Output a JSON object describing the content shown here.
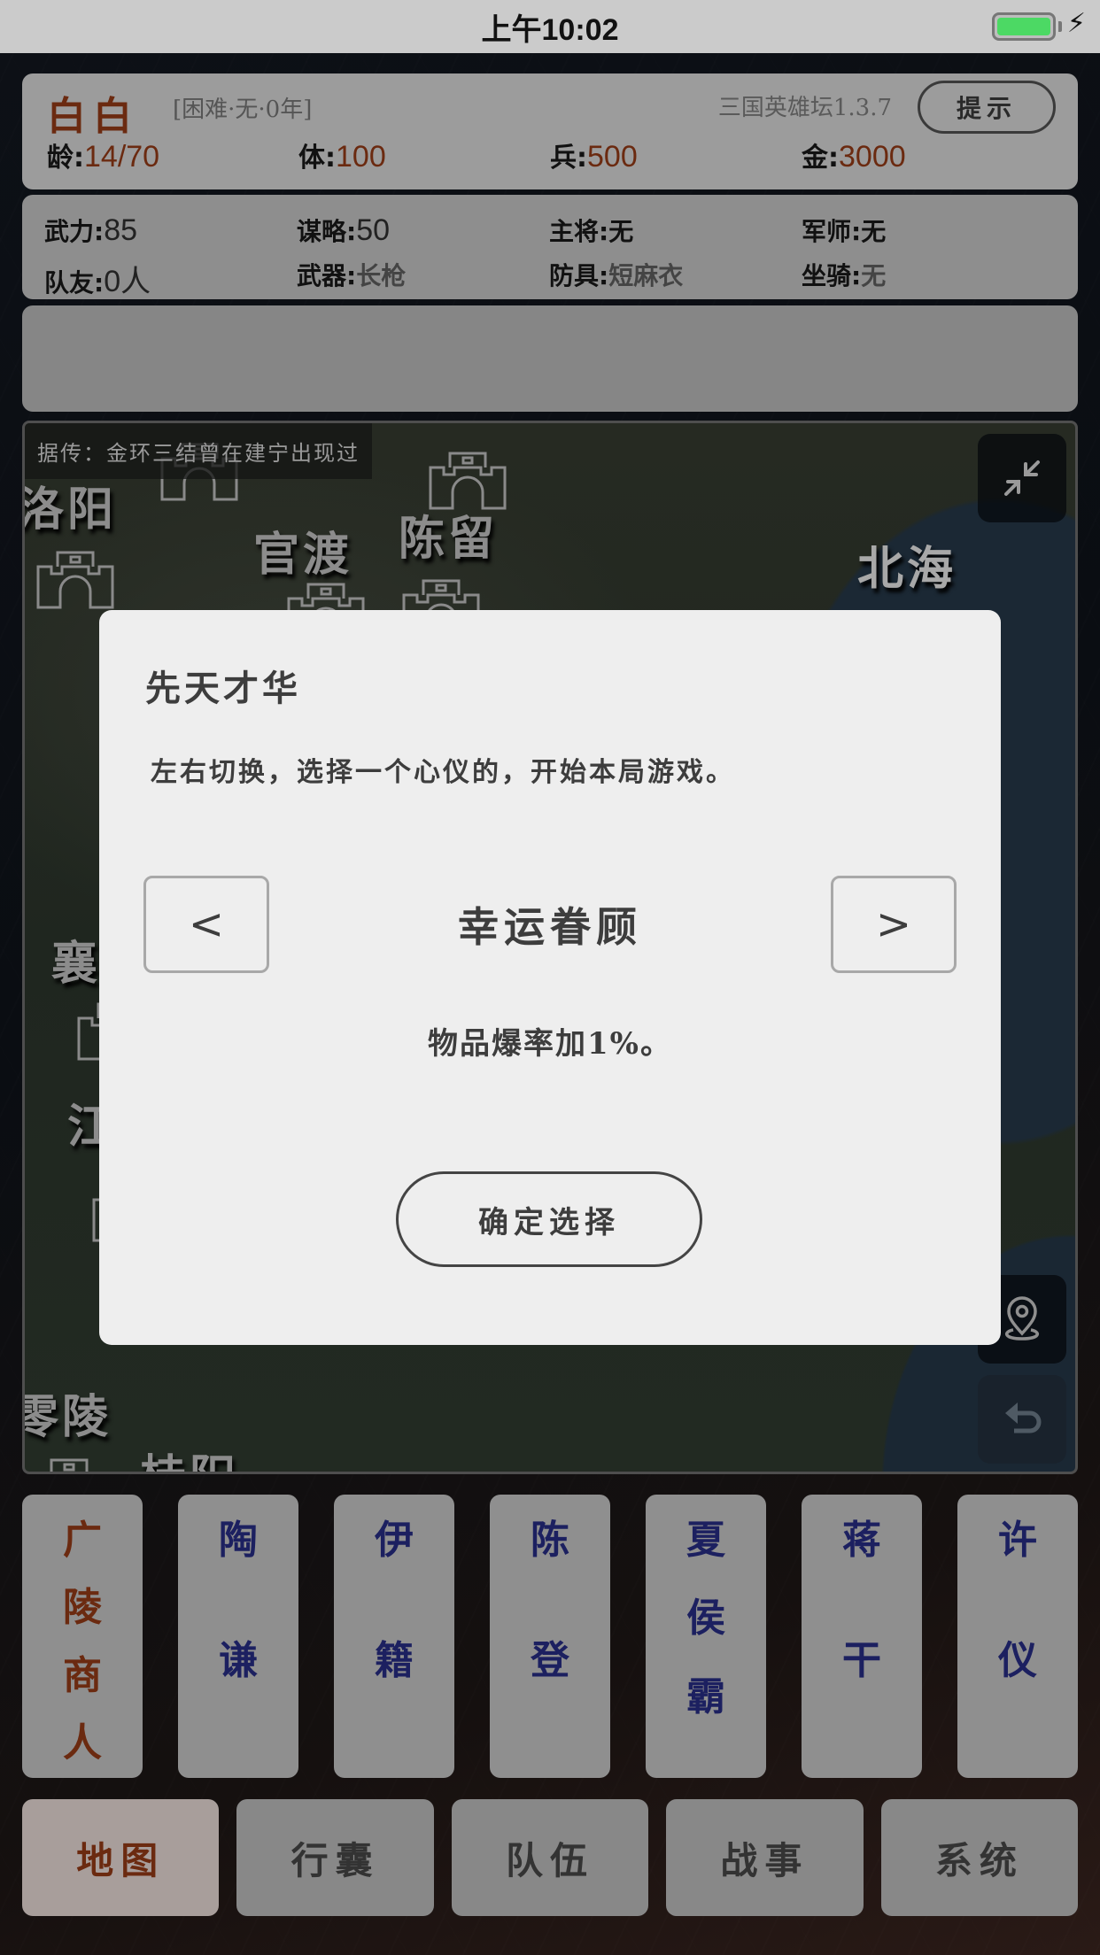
{
  "status_bar": {
    "time": "上午10:02",
    "battery_color": "#4cd964"
  },
  "player": {
    "name": "白白",
    "difficulty": "[困难·无·0年]",
    "game_version": "三国英雄坛1.3.7",
    "hint_button": "提示",
    "stats": [
      {
        "label": "龄:",
        "value": "14/70"
      },
      {
        "label": "体:",
        "value": "100"
      },
      {
        "label": "兵:",
        "value": "500"
      },
      {
        "label": "金:",
        "value": "3000"
      }
    ]
  },
  "attributes": {
    "row1": [
      {
        "label": "武力:",
        "value": "85",
        "kind": "num"
      },
      {
        "label": "谋略:",
        "value": "50",
        "kind": "num"
      },
      {
        "label": "主将:",
        "value": "无",
        "kind": "word"
      },
      {
        "label": "军师:",
        "value": "无",
        "kind": "word"
      }
    ],
    "row2": [
      {
        "label": "队友:",
        "value": "0人",
        "kind": "num"
      },
      {
        "label": "武器:",
        "value": "长枪",
        "kind": "gear"
      },
      {
        "label": "防具:",
        "value": "短麻衣",
        "kind": "gear"
      },
      {
        "label": "坐骑:",
        "value": "无",
        "kind": "gear"
      }
    ]
  },
  "map": {
    "rumor": "据传：金环三结曾在建宁出现过",
    "cities": [
      "洛阳",
      "官渡",
      "陈留",
      "北海",
      "襄",
      "江",
      "零陵",
      "桂阳"
    ],
    "buttons": {
      "collapse": "collapse-icon",
      "locate": "location-pin-icon",
      "back": "undo-icon"
    }
  },
  "modal": {
    "title": "先天才华",
    "description": "左右切换，选择一个心仪的，开始本局游戏。",
    "prev_label": "<",
    "next_label": ">",
    "talent_name": "幸运眷顾",
    "talent_effect": "物品爆率加1%。",
    "confirm_label": "确定选择"
  },
  "characters": [
    {
      "name": [
        "广",
        "陵",
        "商",
        "人"
      ],
      "type": "merchant"
    },
    {
      "name": [
        "陶",
        "谦"
      ],
      "type": "general"
    },
    {
      "name": [
        "伊",
        "籍"
      ],
      "type": "general"
    },
    {
      "name": [
        "陈",
        "登"
      ],
      "type": "general"
    },
    {
      "name": [
        "夏",
        "侯",
        "霸"
      ],
      "type": "general"
    },
    {
      "name": [
        "蒋",
        "干"
      ],
      "type": "general"
    },
    {
      "name": [
        "许",
        "仪"
      ],
      "type": "general"
    }
  ],
  "nav": {
    "active": "地图",
    "tabs": [
      "地图",
      "行囊",
      "队伍",
      "战事",
      "系统"
    ]
  },
  "colors": {
    "accent_brown": "#6b2a10",
    "character_blue": "#1c2060",
    "modal_bg": "#eeeeee"
  }
}
